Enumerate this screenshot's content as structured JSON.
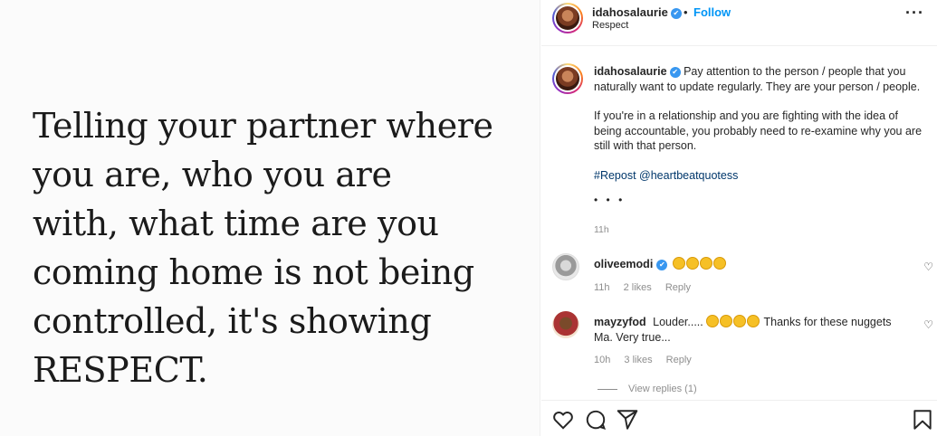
{
  "post": {
    "quote_lines": [
      "Telling your partner where",
      "you are, who you are",
      "with, what time are you",
      "coming home is not being",
      "controlled, it's showing",
      "RESPECT."
    ]
  },
  "header": {
    "username": "idahosalaurie",
    "verified_icon": "✔",
    "separator": "•",
    "follow_label": "Follow",
    "subtitle": "Respect",
    "more_label": "···"
  },
  "caption": {
    "username": "idahosalaurie",
    "text1": "Pay attention to the person / people that you naturally want to update regularly. They are your person / people.",
    "text2": "If you're in a relationship and you are fighting with the idea of being accountable, you probably need to re-examine why you are still with that person.",
    "tags": "#Repost @heartbeatquotess",
    "more": "• • •",
    "time": "11h"
  },
  "comments": [
    {
      "username": "oliveemodi",
      "verified": true,
      "text_before": "",
      "claps": 4,
      "text_after": "",
      "time": "11h",
      "likes": "2 likes",
      "reply": "Reply"
    },
    {
      "username": "mayzyfod",
      "verified": false,
      "text_before": "Louder.....",
      "claps": 4,
      "text_after": "Thanks for these nuggets Ma. Very true...",
      "time": "10h",
      "likes": "3 likes",
      "reply": "Reply"
    }
  ],
  "view_replies": "View replies (1)",
  "icons": {
    "like": "heart-icon",
    "comment": "comment-icon",
    "share": "paper-plane-icon",
    "save": "bookmark-icon"
  }
}
